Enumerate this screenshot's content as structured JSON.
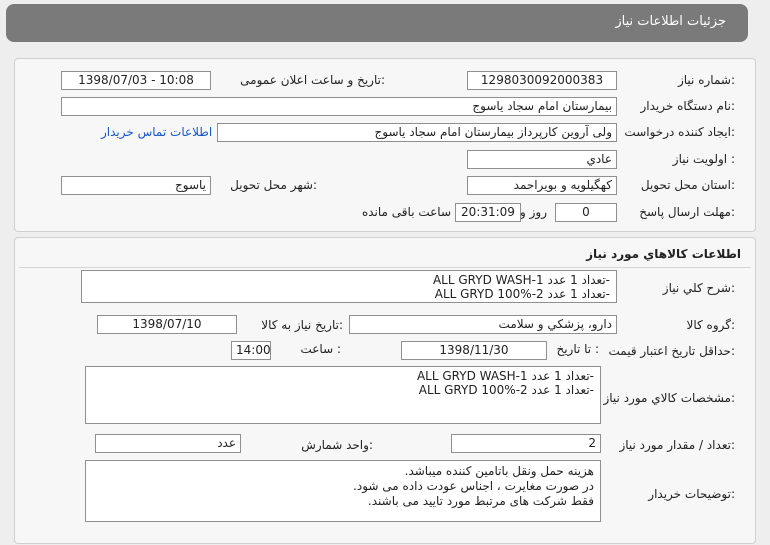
{
  "header": {
    "title": "جزئيات اطلاعات نياز"
  },
  "info": {
    "need_number_label": "شماره نياز:",
    "need_number": "1298030092000383",
    "announce_label": "تاريخ و ساعت اعلان عمومی:",
    "announce_value": "1398/07/03 - 10:08",
    "buyer_label": "نام دستگاه خريدار:",
    "buyer_value": "بيمارستان امام سجاد ياسوج",
    "creator_label": "ايجاد کننده درخواست:",
    "creator_value": "ولی آروین کارپرداز بيمارستان امام سجاد ياسوج",
    "contact_link": "اطلاعات تماس خريدار",
    "priority_label": "اولويت نياز :",
    "priority_value": "عادي",
    "province_label": "استان محل تحويل:",
    "province_value": "کهگيلويه و بويراحمد",
    "city_label": "شهر محل تحويل:",
    "city_value": "ياسوج",
    "deadline_label": "مهلت ارسال پاسخ:",
    "deadline_days": "0",
    "deadline_days_unit": "روز و",
    "deadline_time": "20:31:09",
    "deadline_remaining": "ساعت باقی مانده"
  },
  "goods": {
    "section_title": "اطلاعات کالاهاي مورد نياز",
    "general_desc_label": "شرح کلي نياز:",
    "general_desc": "ALL GRYD WASH-1 تعداد 1 عدد-\nALL GRYD 100%-2 تعداد 1 عدد-",
    "group_label": "گروه کالا:",
    "group_value": "دارو، پزشکي و سلامت",
    "need_date_label": "تاريخ نياز به کالا:",
    "need_date": "1398/07/10",
    "validity_label": "حداقل تاريخ اعتبار قيمت:",
    "until_date_label": "تا تاريخ :",
    "until_date": "1398/11/30",
    "time_label": "ساعت :",
    "time_value": "14:00",
    "spec_label": "مشخصات کالاي مورد نياز:",
    "spec_value": "ALL GRYD WASH-1 تعداد 1 عدد-\nALL GRYD 100%-2 تعداد 1 عدد-",
    "qty_label": "تعداد / مقدار مورد نياز:",
    "qty_value": "2",
    "unit_label": "واحد شمارش:",
    "unit_value": "عدد",
    "notes_label": "توضيحات خريدار:",
    "notes_value": "هزينه حمل ونقل باتامين کننده ميباشد.\nدر صورت مغايرت ، اجناس عودت داده می شود.\nفقط شرکت های مرتبط مورد تاييد می باشند."
  }
}
